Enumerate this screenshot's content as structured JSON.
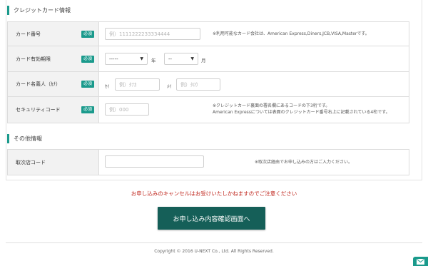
{
  "credit_section": {
    "title": "クレジットカード情報",
    "card_number": {
      "label": "カード番号",
      "required": "必須",
      "placeholder": "例）1111222233334444",
      "note": "※利用可能なカード会社は、American Express,Diners,JCB,VISA,Masterです。"
    },
    "expiry": {
      "label": "カード有効期限",
      "required": "必須",
      "year_value": "-----",
      "year_unit": "年",
      "month_value": "--",
      "month_unit": "月"
    },
    "holder": {
      "label": "カード名義人（ｶﾅ）",
      "required": "必須",
      "sei_label": "ｾｲ",
      "sei_placeholder": "例）ﾀﾅｶ",
      "mei_label": "ﾒｲ",
      "mei_placeholder": "例）ﾀﾛｳ"
    },
    "security": {
      "label": "セキュリティコード",
      "required": "必須",
      "placeholder": "例）000",
      "note_line1": "※クレジットカード裏面の署名欄にあるコードの下3桁です。",
      "note_line2": "American Expressについては表面のクレジットカード番号右上に記載されている4桁です。"
    }
  },
  "other_section": {
    "title": "その他情報",
    "agency_code": {
      "label": "取次店コード",
      "note": "※取次店経由でお申し込みの方はご入力ください。"
    }
  },
  "warning": "お申し込みのキャンセルはお受けいたしかねますのでご注意ください",
  "submit_label": "お申し込み内容確認画面へ",
  "copyright": "Copyright © 2016 U-NEXT Co., Ltd. All Rights Reserved.",
  "colors": {
    "accent": "#1a9a8c",
    "button": "#155f58",
    "warning": "#c0281f"
  }
}
